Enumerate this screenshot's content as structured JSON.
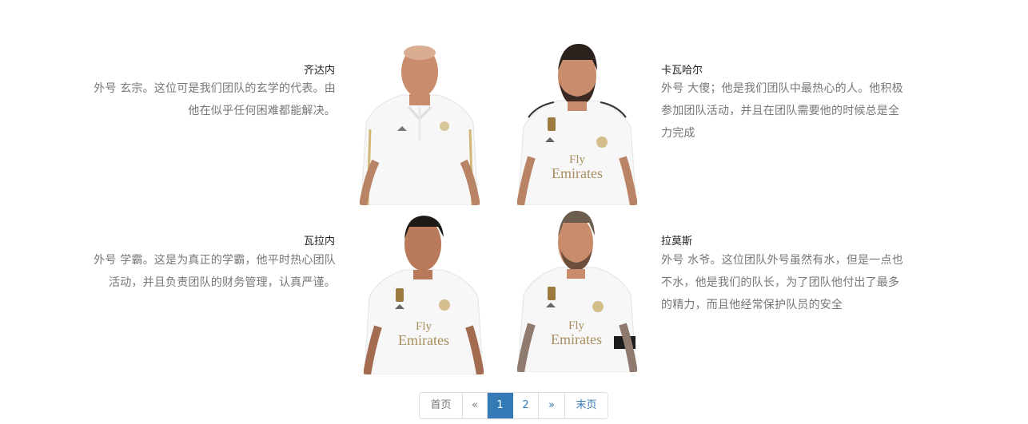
{
  "profiles": [
    {
      "name": "齐达内",
      "description_line1": "外号 玄宗。这位可是我们团队的玄学的代表。由",
      "description_line2": "他在似乎任何困难都能解决。"
    },
    {
      "name": "卡瓦哈尔",
      "description_line1": "外号 大傻；他是我们团队中最热心的人。他积极",
      "description_line2": "参加团队活动，并且在团队需要他的时候总是全",
      "description_line3": "力完成"
    },
    {
      "name": "瓦拉内",
      "description_line1": "外号 学霸。这是为真正的学霸，他平时热心团队",
      "description_line2": "活动，并且负责团队的财务管理，认真严谨。"
    },
    {
      "name": "拉莫斯",
      "description_line1": "外号 水爷。这位团队外号虽然有水，但是一点也",
      "description_line2": "不水，他是我们的队长，为了团队他付出了最多",
      "description_line3": "的精力，而且他经常保护队员的安全"
    }
  ],
  "pagination": {
    "first": "首页",
    "prev": "«",
    "page1": "1",
    "page2": "2",
    "next": "»",
    "last": "末页"
  },
  "colors": {
    "accent": "#337ab7",
    "desc_text": "#777777",
    "name_text": "#222222",
    "jersey_white": "#f7f7f7",
    "gold": "#b89a55"
  },
  "icons": {
    "club_crest": "crest-icon",
    "sponsor_text": "Fly Emirates"
  }
}
